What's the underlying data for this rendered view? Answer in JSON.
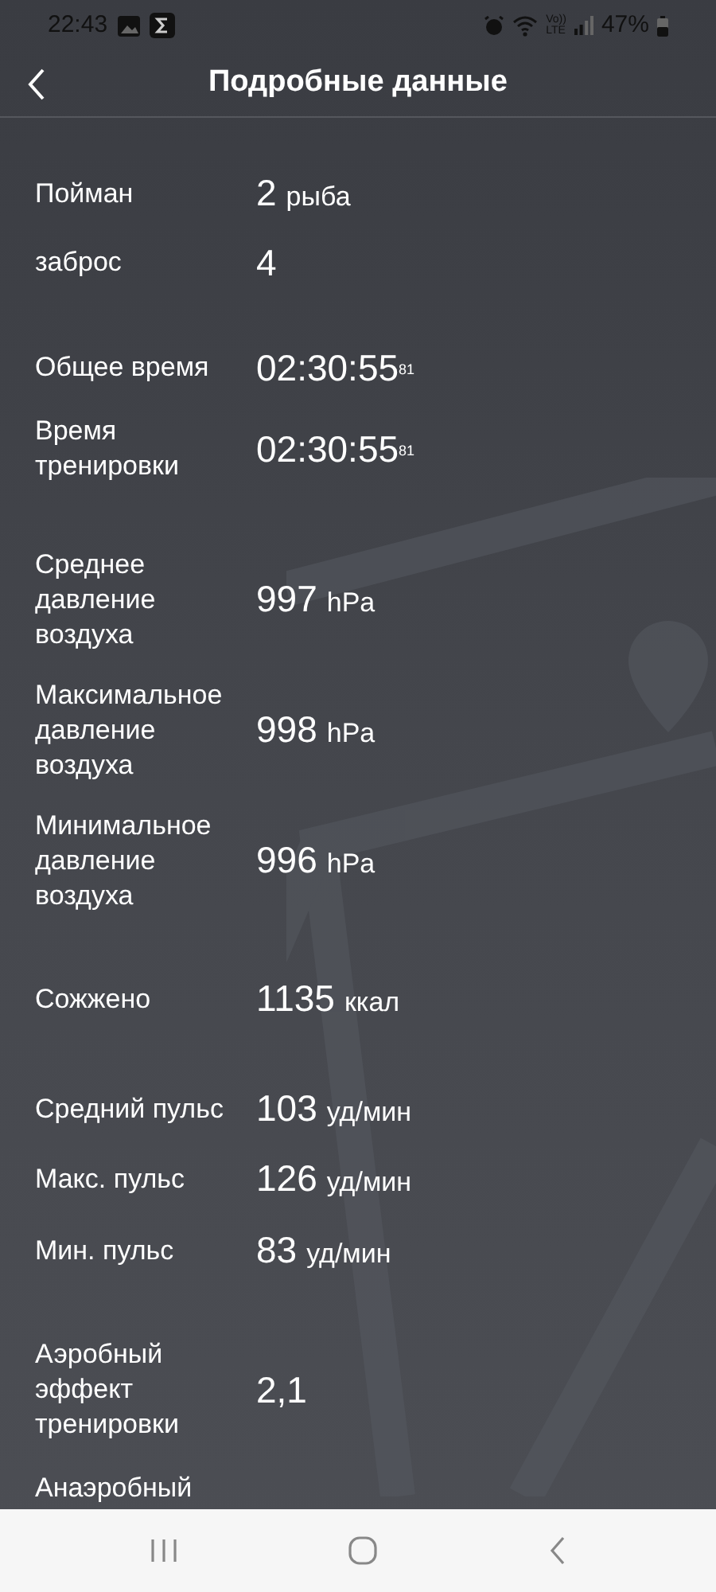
{
  "status_bar": {
    "time": "22:43",
    "volte": [
      "Vo))",
      "LTE"
    ],
    "battery": "47%"
  },
  "header": {
    "title": "Подробные данные"
  },
  "groups": [
    {
      "rows": [
        {
          "label": "Пойман",
          "value": "2",
          "unit": "рыба"
        },
        {
          "label": "заброс",
          "value": "4"
        }
      ]
    },
    {
      "rows": [
        {
          "label": "Общее время",
          "value": "02:30:55$^{81}$"
        },
        {
          "label": "Время тренировки",
          "value": "02:30:55$^{81}$"
        }
      ]
    },
    {
      "rows": [
        {
          "label": "Среднее давление воздуха",
          "value": "997",
          "unit": "hPa"
        },
        {
          "label": "Максимальное давление воздуха",
          "value": "998",
          "unit": "hPa"
        },
        {
          "label": "Минимальное давление воздуха",
          "value": "996",
          "unit": "hPa"
        }
      ]
    },
    {
      "rows": [
        {
          "label": "Сожжено",
          "value": "1135",
          "unit": "ккал"
        }
      ]
    },
    {
      "rows": [
        {
          "label": "Средний пульс",
          "value": "103",
          "unit": "уд/мин"
        },
        {
          "label": "Макс. пульс",
          "value": "126",
          "unit": "уд/мин"
        },
        {
          "label": "Мин. пульс",
          "value": "83",
          "unit": "уд/мин"
        }
      ]
    },
    {
      "rows": [
        {
          "label": "Аэробный эффект тренировки",
          "value": "2,1"
        },
        {
          "label": "Анаэробный"
        }
      ]
    }
  ]
}
